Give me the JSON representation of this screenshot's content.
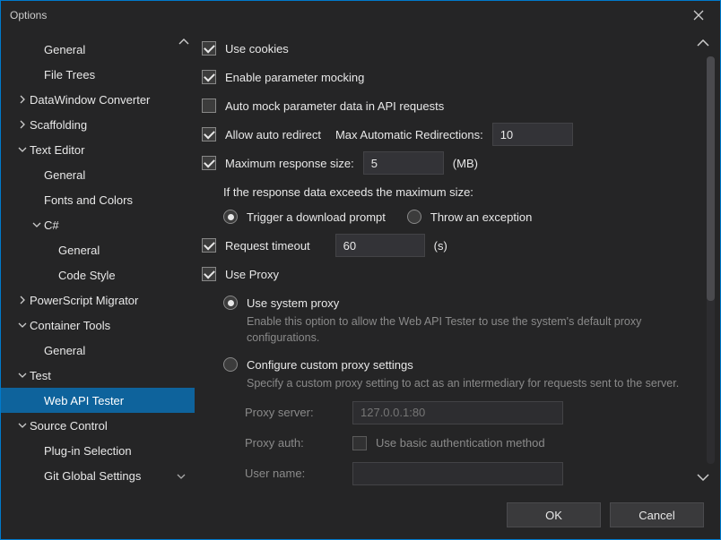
{
  "title": "Options",
  "sidebar": {
    "items": [
      {
        "label": "General",
        "level": 1,
        "chev": ""
      },
      {
        "label": "File Trees",
        "level": 1,
        "chev": ""
      },
      {
        "label": "DataWindow Converter",
        "level": 0,
        "chev": "right"
      },
      {
        "label": "Scaffolding",
        "level": 0,
        "chev": "right"
      },
      {
        "label": "Text Editor",
        "level": 0,
        "chev": "down"
      },
      {
        "label": "General",
        "level": 1,
        "chev": ""
      },
      {
        "label": "Fonts and Colors",
        "level": 1,
        "chev": ""
      },
      {
        "label": "C#",
        "level": 1,
        "chev": "down"
      },
      {
        "label": "General",
        "level": 2,
        "chev": ""
      },
      {
        "label": "Code Style",
        "level": 2,
        "chev": ""
      },
      {
        "label": "PowerScript Migrator",
        "level": 0,
        "chev": "right"
      },
      {
        "label": "Container Tools",
        "level": 0,
        "chev": "down"
      },
      {
        "label": "General",
        "level": 1,
        "chev": ""
      },
      {
        "label": "Test",
        "level": 0,
        "chev": "down"
      },
      {
        "label": "Web API Tester",
        "level": 1,
        "chev": "",
        "selected": true
      },
      {
        "label": "Source Control",
        "level": 0,
        "chev": "down"
      },
      {
        "label": "Plug-in Selection",
        "level": 1,
        "chev": ""
      },
      {
        "label": "Git Global Settings",
        "level": 1,
        "chev": "",
        "trailing": "down"
      }
    ]
  },
  "main": {
    "useCookies": {
      "label": "Use cookies",
      "checked": true
    },
    "paramMocking": {
      "label": "Enable parameter mocking",
      "checked": true
    },
    "autoMock": {
      "label": "Auto mock parameter data in API requests",
      "checked": false
    },
    "allowRedirect": {
      "label": "Allow auto redirect",
      "checked": true,
      "maxLabel": "Max Automatic Redirections:",
      "maxValue": "10"
    },
    "maxResp": {
      "label": "Maximum response size:",
      "checked": true,
      "value": "5",
      "unit": "(MB)"
    },
    "overflow": {
      "prompt": "If the response data exceeds the maximum size:",
      "optDownload": "Trigger a download prompt",
      "optThrow": "Throw an exception",
      "selected": "download"
    },
    "timeout": {
      "label": "Request timeout",
      "checked": true,
      "value": "60",
      "unit": "(s)"
    },
    "useProxy": {
      "label": "Use Proxy",
      "checked": true
    },
    "proxySystem": {
      "label": "Use system proxy",
      "desc": "Enable this option to allow the Web API Tester to use the system's default proxy configurations."
    },
    "proxyCustom": {
      "label": "Configure custom proxy settings",
      "desc": "Specify a custom proxy setting to act as an intermediary for requests sent to the server."
    },
    "proxySelected": "system",
    "proxyServer": {
      "label": "Proxy server:",
      "placeholder": "127.0.0.1:80"
    },
    "proxyAuth": {
      "label": "Proxy auth:",
      "chkLabel": "Use basic authentication method"
    },
    "userName": {
      "label": "User name:",
      "value": ""
    }
  },
  "footer": {
    "ok": "OK",
    "cancel": "Cancel"
  }
}
